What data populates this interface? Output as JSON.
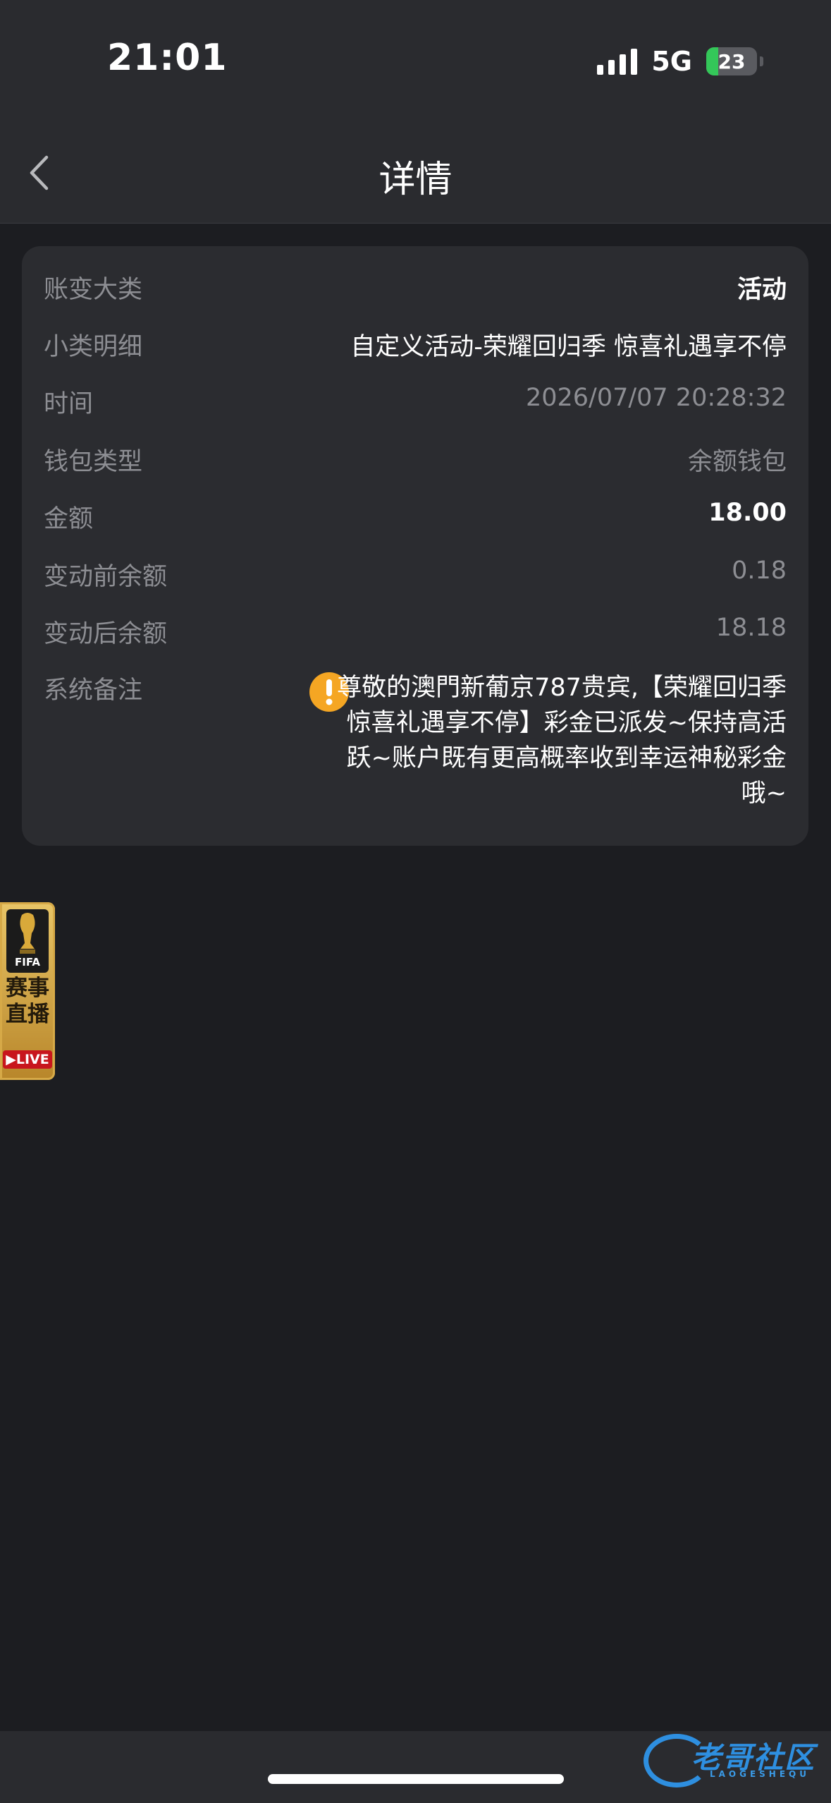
{
  "status_bar": {
    "time": "21:01",
    "network": "5G",
    "battery": "23",
    "battery_level": 0.23
  },
  "nav": {
    "title": "详情"
  },
  "details": [
    {
      "label": "账变大类",
      "value": "活动",
      "style": "bold"
    },
    {
      "label": "小类明细",
      "value": "自定义活动-荣耀回归季 惊喜礼遇享不停",
      "style": "white"
    },
    {
      "label": "时间",
      "value": "2026/07/07 20:28:32",
      "style": "muted"
    },
    {
      "label": "钱包类型",
      "value": "余额钱包",
      "style": "muted"
    },
    {
      "label": "金额",
      "value": "18.00",
      "style": "bold"
    },
    {
      "label": "变动前余额",
      "value": "0.18",
      "style": "muted"
    },
    {
      "label": "变动后余额",
      "value": "18.18",
      "style": "muted"
    }
  ],
  "remark": {
    "label": "系统备注",
    "icon": "warning-icon",
    "text": "尊敬的澳門新葡京787贵宾,【荣耀回归季 惊喜礼遇享不停】彩金已派发~保持高活跃~账户既有更高概率收到幸运神秘彩金哦~"
  },
  "floating_banner": {
    "badge": "FIFA",
    "title": "赛事直播",
    "live": "▶LIVE"
  },
  "watermark": {
    "text": "老哥社区",
    "sub": "LAOGESHEQU"
  },
  "colors": {
    "background": "#1c1d21",
    "card": "#2b2c30",
    "muted_text": "#8d8e93",
    "warning": "#f5a623"
  }
}
